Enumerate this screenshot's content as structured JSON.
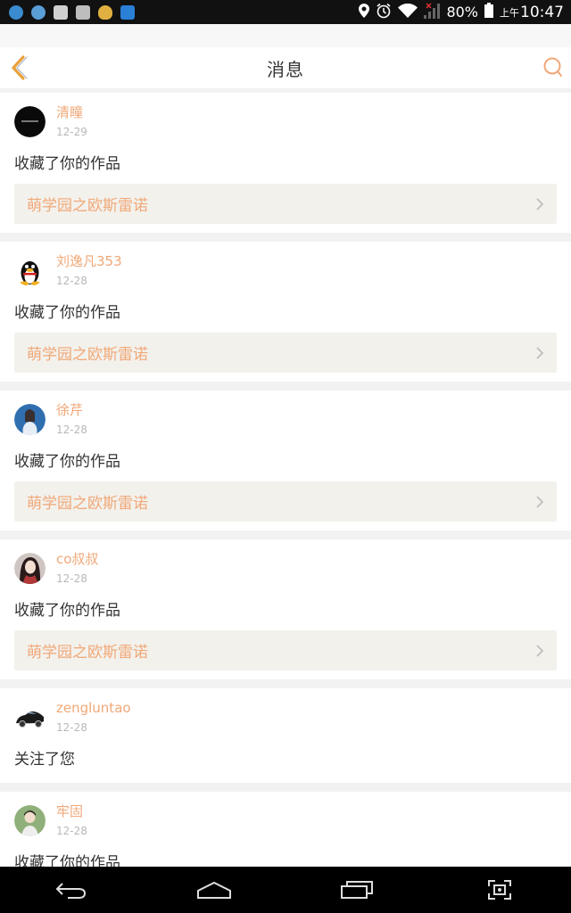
{
  "status_bar": {
    "battery": "80%",
    "ampm": "上午",
    "time": "10:47"
  },
  "header": {
    "title": "消息",
    "back_icon": "chevron-left-icon",
    "search_icon": "search-icon"
  },
  "colors": {
    "accent": "#f0a878",
    "link_bg": "#f3f1ec"
  },
  "messages": [
    {
      "user": "清瞳",
      "date": "12-29",
      "action": "收藏了你的作品",
      "work": "萌学园之欧斯雷诺"
    },
    {
      "user": "刘逸凡353",
      "date": "12-28",
      "action": "收藏了你的作品",
      "work": "萌学园之欧斯雷诺"
    },
    {
      "user": "徐芹",
      "date": "12-28",
      "action": "收藏了你的作品",
      "work": "萌学园之欧斯雷诺"
    },
    {
      "user": "co叔叔",
      "date": "12-28",
      "action": "收藏了你的作品",
      "work": "萌学园之欧斯雷诺"
    },
    {
      "user": "zengluntao",
      "date": "12-28",
      "action": "关注了您"
    },
    {
      "user": "牢固",
      "date": "12-28",
      "action": "收藏了你的作品"
    }
  ]
}
